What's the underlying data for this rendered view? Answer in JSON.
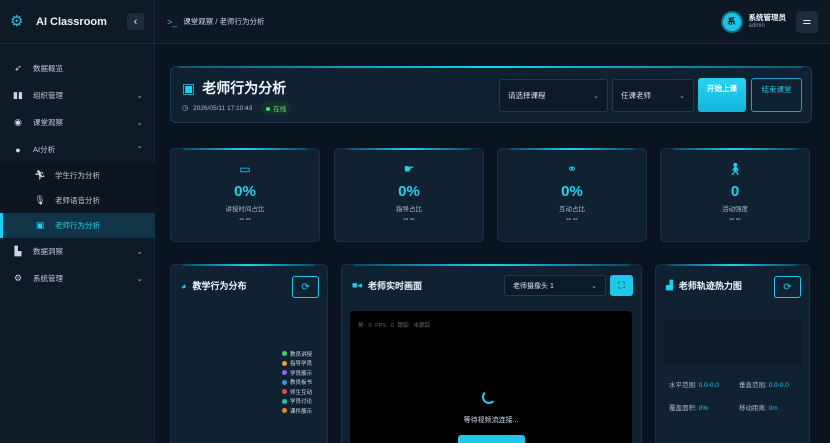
{
  "app": {
    "name": "AI Classroom"
  },
  "sidebar": {
    "items": [
      {
        "label": "数据概览"
      },
      {
        "label": "组织管理"
      },
      {
        "label": "课堂观察"
      },
      {
        "label": "AI分析"
      },
      {
        "label": "数据洞察"
      },
      {
        "label": "系统管理"
      }
    ],
    "sub_items": [
      {
        "label": "学生行为分析"
      },
      {
        "label": "老师语音分析"
      },
      {
        "label": "老师行为分析"
      }
    ]
  },
  "header": {
    "breadcrumb": "课堂观察 / 老师行为分析",
    "user": {
      "avatar_text": "系",
      "name": "系统管理员",
      "role": "admin"
    }
  },
  "page": {
    "title": "老师行为分析",
    "datetime": "2026/05/11 17:10:43",
    "status": "在线",
    "course_select": "请选择课程",
    "teacher_select": "任课老师",
    "start_button": "开始上课",
    "end_button": "结束课堂"
  },
  "stats": [
    {
      "value": "0%",
      "label": "讲授时间占比",
      "detail": "-- --"
    },
    {
      "value": "0%",
      "label": "指导占比",
      "detail": "-- --"
    },
    {
      "value": "0%",
      "label": "互动占比",
      "detail": "-- --"
    },
    {
      "value": "0",
      "label": "活动强度",
      "detail": "-- --"
    }
  ],
  "distribution": {
    "title": "教学行为分布",
    "legend": [
      {
        "label": "教员讲授",
        "color": "#3ecf6a"
      },
      {
        "label": "指导学员",
        "color": "#f0a020"
      },
      {
        "label": "学员展示",
        "color": "#a05ee0"
      },
      {
        "label": "教员板书",
        "color": "#2f9be8"
      },
      {
        "label": "师生互动",
        "color": "#e8503a"
      },
      {
        "label": "学员讨论",
        "color": "#25c4a0"
      },
      {
        "label": "课件展示",
        "color": "#f08030"
      }
    ]
  },
  "video": {
    "title": "老师实时画面",
    "camera_select": "老师摄像头 1",
    "info": "帧: 0   FPS: 0   跟踪: 未跟踪",
    "status_text": "等待视频流连接..."
  },
  "heatmap": {
    "title": "老师轨迹热力图",
    "h_range_label": "水平范围:",
    "h_range_value": "0.0-0.0",
    "v_range_label": "垂直范围:",
    "v_range_value": "0.0-0.0",
    "area_label": "覆盖面积:",
    "area_value": "0%",
    "distance_label": "移动距离:",
    "distance_value": "0m"
  }
}
